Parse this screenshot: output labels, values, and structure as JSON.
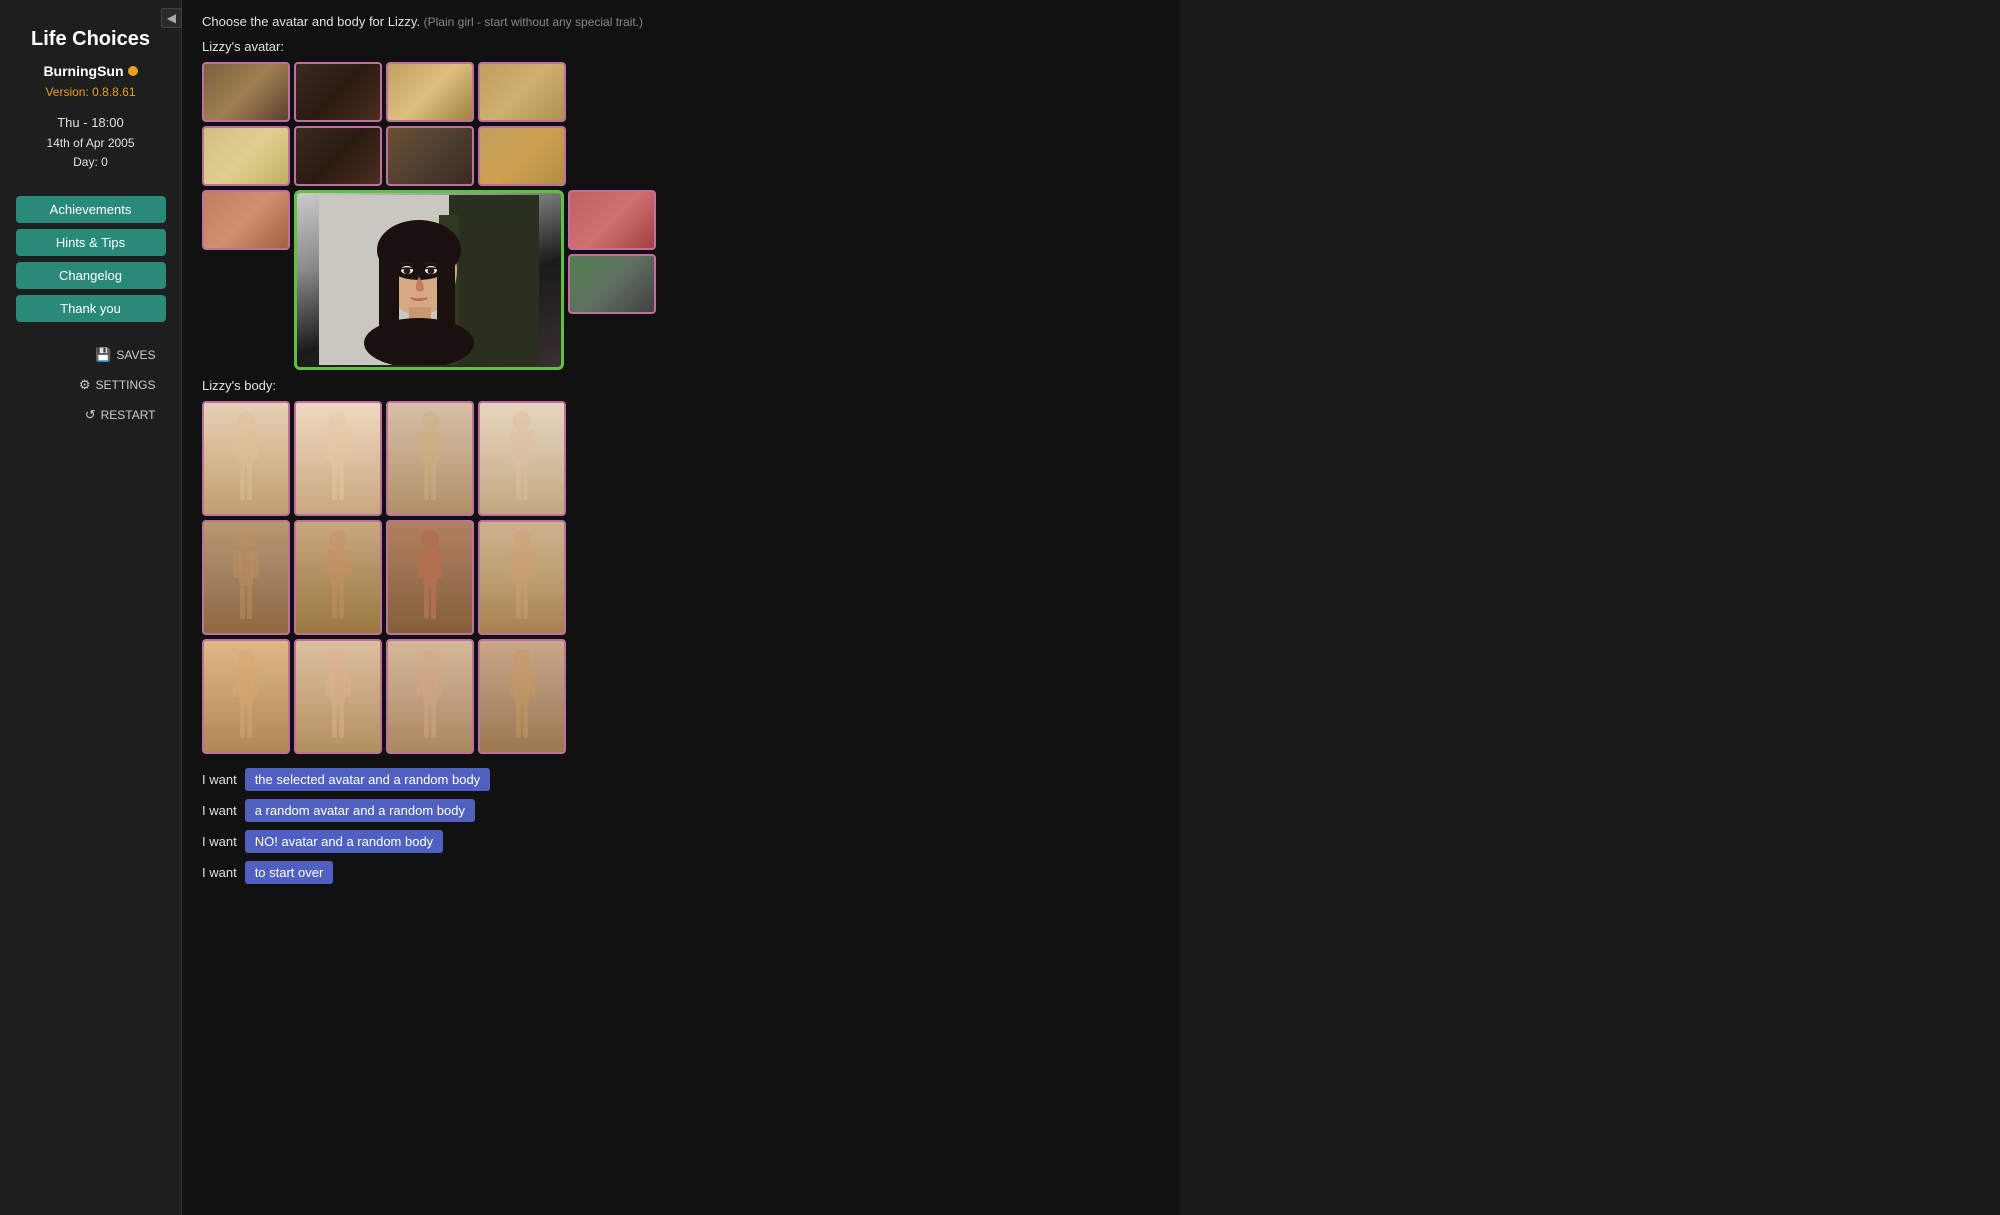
{
  "sidebar": {
    "collapse_icon": "◀",
    "title": "Life Choices",
    "username": "BurningSun",
    "version_label": "Version: 0.8.8.61",
    "time": "Thu - 18:00",
    "date": "14th of Apr 2005",
    "day": "Day: 0",
    "nav_buttons": [
      {
        "id": "achievements",
        "label": "Achievements"
      },
      {
        "id": "hints",
        "label": "Hints & Tips"
      },
      {
        "id": "changelog",
        "label": "Changelog"
      },
      {
        "id": "thankyou",
        "label": "Thank you"
      }
    ],
    "util_buttons": [
      {
        "id": "saves",
        "label": "SAVES",
        "icon": "💾"
      },
      {
        "id": "settings",
        "label": "SETTINGS",
        "icon": "⚙"
      },
      {
        "id": "restart",
        "label": "RESTART",
        "icon": "↺"
      }
    ]
  },
  "main": {
    "instruction": "Choose the avatar and body for Lizzy.",
    "trait_note": "(Plain girl - start without any special trait.)",
    "avatar_label": "Lizzy's avatar:",
    "body_label": "Lizzy's body:",
    "action_rows": [
      {
        "prefix": "I want",
        "btn_label": "the selected avatar and a random body"
      },
      {
        "prefix": "I want",
        "btn_label": "a random avatar and a random body"
      },
      {
        "prefix": "I want",
        "btn_label": "NO! avatar and a random body"
      },
      {
        "prefix": "I want",
        "btn_label": "to start over"
      }
    ]
  }
}
